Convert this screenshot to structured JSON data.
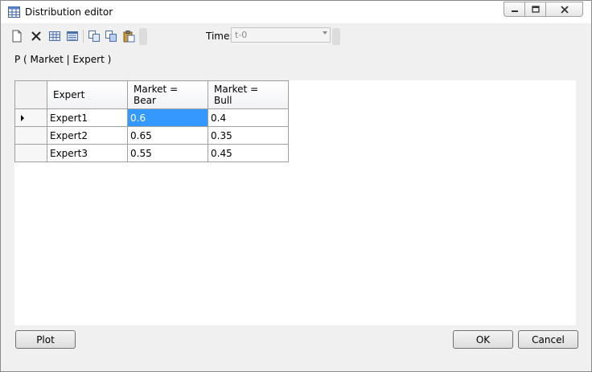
{
  "window": {
    "title": "Distribution editor"
  },
  "toolbar": {
    "time_label": "Time:",
    "time_value": "t-0"
  },
  "formula": "P ( Market | Expert )",
  "grid": {
    "columns": [
      "Expert",
      "Market =\nBear",
      "Market =\nBull"
    ],
    "column_lines": [
      [
        "Expert"
      ],
      [
        "Market =",
        "Bear"
      ],
      [
        "Market =",
        "Bull"
      ]
    ],
    "rows": [
      {
        "expert": "Expert1",
        "bear": "0.6",
        "bull": "0.4"
      },
      {
        "expert": "Expert2",
        "bear": "0.65",
        "bull": "0.35"
      },
      {
        "expert": "Expert3",
        "bear": "0.55",
        "bull": "0.45"
      }
    ]
  },
  "buttons": {
    "plot": "Plot",
    "ok": "OK",
    "cancel": "Cancel"
  },
  "colors": {
    "selection": "#3399ff",
    "window_bg": "#f0f0f0"
  },
  "icons": [
    "table-icon",
    "new-doc-icon",
    "delete-icon",
    "grid-icon",
    "list-icon",
    "copy-icon",
    "copy-alt-icon",
    "paste-icon"
  ]
}
